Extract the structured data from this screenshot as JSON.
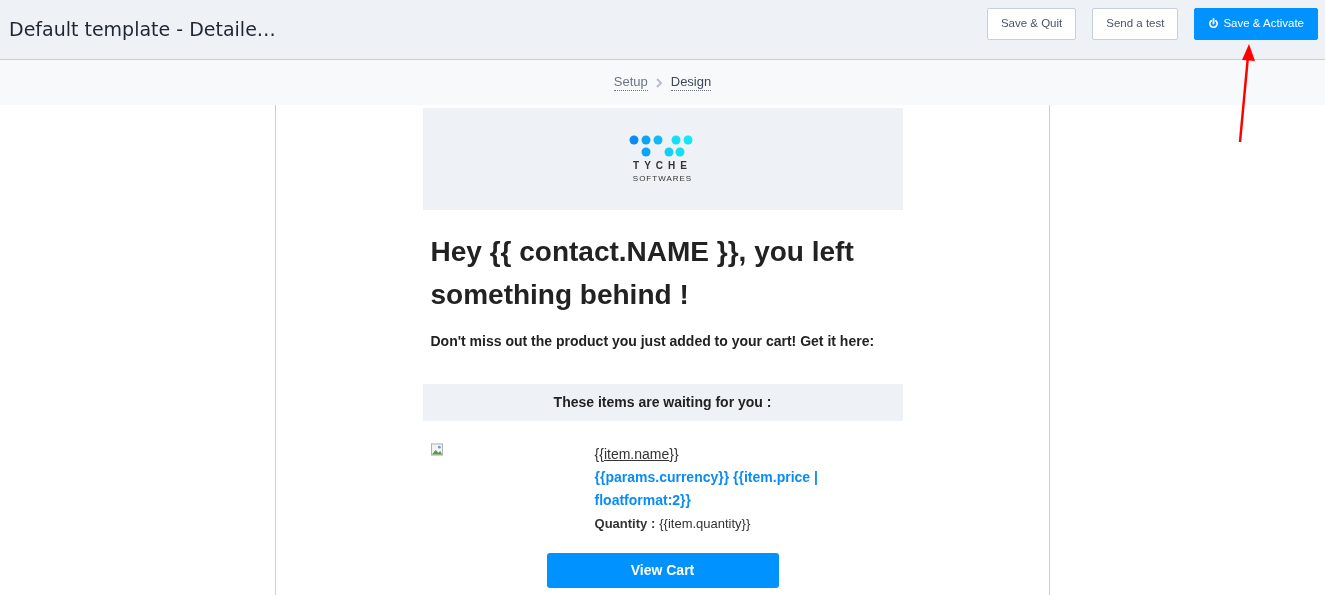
{
  "header": {
    "title": "Default template - Detaile…",
    "buttons": [
      {
        "label": "Save & Quit",
        "kind": "outline"
      },
      {
        "label": "Send a test",
        "kind": "outline"
      },
      {
        "label": "Save & Activate",
        "kind": "primary"
      }
    ]
  },
  "steps": [
    {
      "label": "Setup",
      "selected": false
    },
    {
      "label": "Design",
      "selected": true
    }
  ],
  "email": {
    "logo": {
      "name": "TYCHE",
      "tagline": "SOFTWARES"
    },
    "heading": "Hey {{ contact.NAME }}, you left something behind !",
    "intro": "Don't miss out the product you just added to your cart! Get it here:",
    "items_title": "These items are waiting for you :",
    "item": {
      "name": "{{*item.name*}}",
      "price": "{{params.currency}} {{item.price | floatformat:2}}",
      "quantity_label": "Quantity :",
      "quantity": "{{item.quantity}}"
    },
    "cta": "View Cart"
  }
}
